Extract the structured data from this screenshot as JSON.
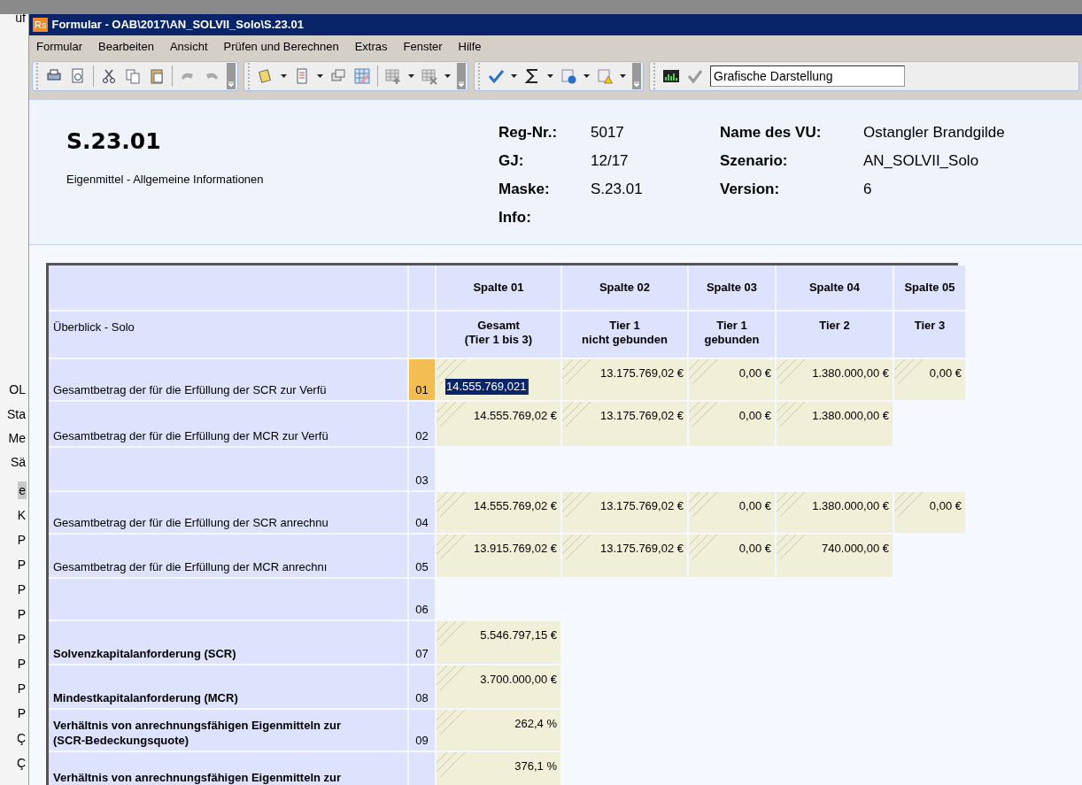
{
  "background_window": {
    "fragments": [
      {
        "text": "üf",
        "selected": false
      },
      {
        "text": "OL",
        "selected": false
      },
      {
        "text": "Sta",
        "selected": false
      },
      {
        "text": "Me",
        "selected": false
      },
      {
        "text": "Sä",
        "selected": false
      },
      {
        "text": "e",
        "selected": true
      },
      {
        "text": "K",
        "selected": false
      },
      {
        "text": "P",
        "selected": false
      },
      {
        "text": "P",
        "selected": false
      },
      {
        "text": "P",
        "selected": false
      },
      {
        "text": "P",
        "selected": false
      },
      {
        "text": "P",
        "selected": false
      },
      {
        "text": "P",
        "selected": false
      },
      {
        "text": "P",
        "selected": false
      },
      {
        "text": "P",
        "selected": false
      },
      {
        "text": "Ç",
        "selected": false
      },
      {
        "text": "Ç",
        "selected": false
      }
    ]
  },
  "window": {
    "title": "Formular - OAB\\2017\\AN_SOLVII_Solo\\S.23.01",
    "app_badge": "Rs"
  },
  "menu": [
    "Formular",
    "Bearbeiten",
    "Ansicht",
    "Prüfen und Berechnen",
    "Extras",
    "Fenster",
    "Hilfe"
  ],
  "toolbar": {
    "view_select": "Grafische Darstellung"
  },
  "header": {
    "code": "S.23.01",
    "subtitle": "Eigenmittel - Allgemeine Informationen",
    "fields_left": [
      {
        "label": "Reg-Nr.:",
        "value": "5017"
      },
      {
        "label": "GJ:",
        "value": "12/17"
      },
      {
        "label": "Maske:",
        "value": "S.23.01"
      },
      {
        "label": "Info:"
      }
    ],
    "fields_right": [
      {
        "label": "Name des VU:",
        "value": "Ostangler Brandgilde"
      },
      {
        "label": "Szenario:",
        "value": "AN_SOLVII_Solo"
      },
      {
        "label": "Version:",
        "value": "6"
      }
    ]
  },
  "table": {
    "title": "Überblick - Solo",
    "columns": [
      {
        "code": "Spalte 01",
        "label": "Gesamt\n(Tier 1 bis 3)"
      },
      {
        "code": "Spalte 02",
        "label": "Tier 1\nnicht gebunden"
      },
      {
        "code": "Spalte 03",
        "label": "Tier 1\ngebunden"
      },
      {
        "code": "Spalte 04",
        "label": "Tier 2"
      },
      {
        "code": "Spalte 05",
        "label": "Tier 3"
      }
    ],
    "rows": [
      {
        "label": "Gesamtbetrag der für die Erfüllung der SCR zur Verfü",
        "bold": false,
        "number": "01",
        "selected": true,
        "cells": [
          {
            "value": "14.555.769,021",
            "selected": true
          },
          {
            "value": "13.175.769,02 €",
            "selected": false
          },
          {
            "value": "0,00 €",
            "selected": false
          },
          {
            "value": "1.380.000,00 €",
            "selected": false
          },
          {
            "value": "0,00 €",
            "selected": false
          }
        ]
      },
      {
        "label": "Gesamtbetrag der für die Erfüllung der MCR zur Verfü",
        "bold": false,
        "number": "02",
        "selected": false,
        "cells": [
          {
            "value": "14.555.769,02 €",
            "selected": false
          },
          {
            "value": "13.175.769,02 €",
            "selected": false
          },
          {
            "value": "0,00 €",
            "selected": false
          },
          {
            "value": "1.380.000,00 €",
            "selected": false
          }
        ]
      },
      {
        "number": "03",
        "selected": false
      },
      {
        "label": "Gesamtbetrag der für die Erfüllung der SCR anrechnu",
        "bold": false,
        "number": "04",
        "selected": false,
        "cells": [
          {
            "value": "14.555.769,02 €",
            "selected": false
          },
          {
            "value": "13.175.769,02 €",
            "selected": false
          },
          {
            "value": "0,00 €",
            "selected": false
          },
          {
            "value": "1.380.000,00 €",
            "selected": false
          },
          {
            "value": "0,00 €",
            "selected": false
          }
        ]
      },
      {
        "label": "Gesamtbetrag der für die Erfüllung der MCR anrechnı",
        "bold": false,
        "number": "05",
        "selected": false,
        "cells": [
          {
            "value": "13.915.769,02 €",
            "selected": false
          },
          {
            "value": "13.175.769,02 €",
            "selected": false
          },
          {
            "value": "0,00 €",
            "selected": false
          },
          {
            "value": "740.000,00 €",
            "selected": false
          }
        ]
      },
      {
        "number": "06",
        "selected": false
      },
      {
        "label": "Solvenzkapitalanforderung (SCR)",
        "bold": true,
        "number": "07",
        "selected": false,
        "cells": [
          {
            "value": "5.546.797,15 €",
            "selected": false
          }
        ]
      },
      {
        "label": "Mindestkapitalanforderung (MCR)",
        "bold": true,
        "number": "08",
        "selected": false,
        "cells": [
          {
            "value": "3.700.000,00 €",
            "selected": false
          }
        ]
      },
      {
        "label": "Verhältnis von anrechnungsfähigen Eigenmitteln zur\n(SCR-Bedeckungsquote)",
        "bold": true,
        "number": "09",
        "selected": false,
        "cells": [
          {
            "value": "262,4 %",
            "selected": false
          }
        ]
      },
      {
        "label": "Verhältnis von anrechnungsfähigen Eigenmitteln zur",
        "bold": true,
        "selected": false,
        "cells": [
          {
            "value": "376,1 %",
            "selected": false
          }
        ]
      }
    ]
  }
}
